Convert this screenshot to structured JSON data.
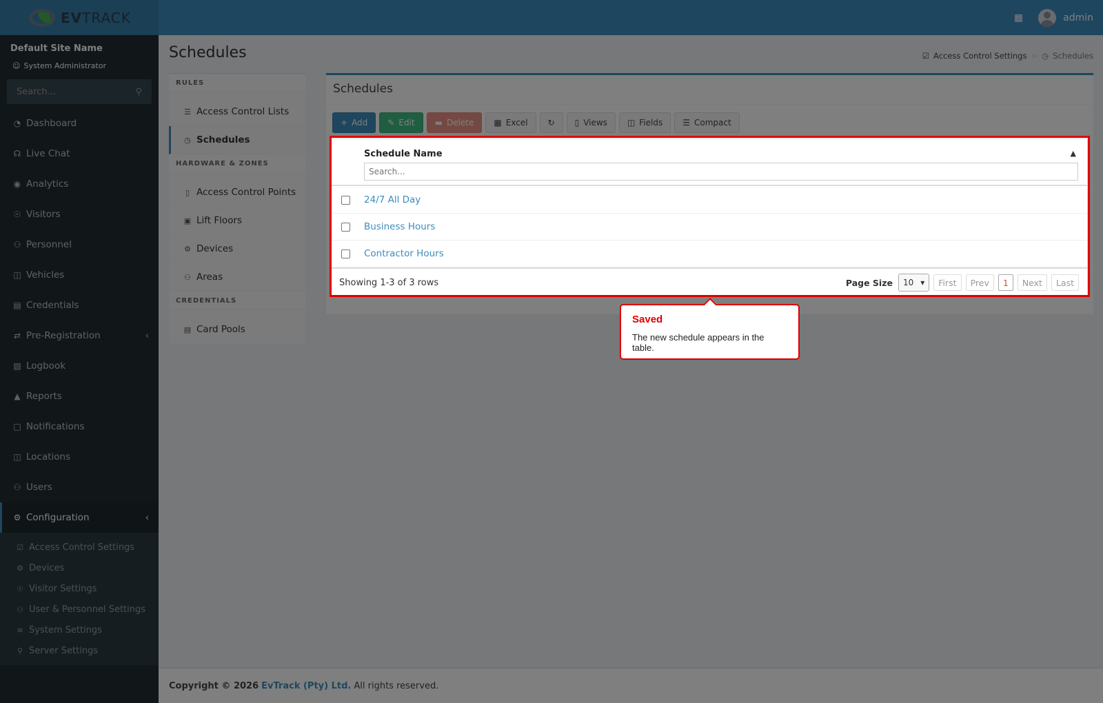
{
  "brand": {
    "logo_bold": "EV",
    "logo_rest": "TRACK",
    "user": "admin",
    "building_icon": "building-icon"
  },
  "sidebar": {
    "site_name": "Default Site Name",
    "role": "System Administrator",
    "search_placeholder": "Search...",
    "items": [
      {
        "label": "Dashboard",
        "icon": "dashboard-icon"
      },
      {
        "label": "Live Chat",
        "icon": "headset-icon"
      },
      {
        "label": "Analytics",
        "icon": "target-icon"
      },
      {
        "label": "Visitors",
        "icon": "eye-icon"
      },
      {
        "label": "Personnel",
        "icon": "user-cog-icon"
      },
      {
        "label": "Vehicles",
        "icon": "car-icon"
      },
      {
        "label": "Credentials",
        "icon": "id-card-icon"
      },
      {
        "label": "Pre-Registration",
        "icon": "arrows-icon"
      },
      {
        "label": "Logbook",
        "icon": "book-icon"
      },
      {
        "label": "Reports",
        "icon": "chart-icon"
      },
      {
        "label": "Notifications",
        "icon": "chat-icon"
      },
      {
        "label": "Locations",
        "icon": "map-icon"
      },
      {
        "label": "Users",
        "icon": "users-icon"
      },
      {
        "label": "Configuration",
        "icon": "gear-icon"
      }
    ],
    "sub_items": [
      {
        "label": "Access Control Settings",
        "icon": "lock-icon"
      },
      {
        "label": "Devices",
        "icon": "cog-icon"
      },
      {
        "label": "Visitor Settings",
        "icon": "eye-icon"
      },
      {
        "label": "User & Personnel Settings",
        "icon": "user-cog-icon"
      },
      {
        "label": "System Settings",
        "icon": "sliders-icon"
      },
      {
        "label": "Server Settings",
        "icon": "server-icon"
      }
    ]
  },
  "page": {
    "title": "Schedules",
    "breadcrumb": {
      "parent": "Access Control Settings",
      "separator": ">",
      "current": "Schedules"
    }
  },
  "left_menu": {
    "sections": [
      {
        "heading": "RULES",
        "items": [
          "Access Control Lists",
          "Schedules"
        ]
      },
      {
        "heading": "HARDWARE & ZONES",
        "items": [
          "Access Control Points",
          "Lift Floors",
          "Devices",
          "Areas"
        ]
      },
      {
        "heading": "CREDENTIALS",
        "items": [
          "Card Pools"
        ]
      }
    ]
  },
  "main": {
    "title": "Schedules",
    "toolbar": {
      "add": "Add",
      "edit": "Edit",
      "delete": "Delete",
      "excel": "Excel",
      "views": "Views",
      "fields": "Fields",
      "compact": "Compact"
    },
    "grid": {
      "column": "Schedule Name",
      "search_placeholder": "Search...",
      "rows": [
        "24/7 All Day",
        "Business Hours",
        "Contractor Hours"
      ],
      "showing": "Showing 1-3 of 3 rows",
      "page_size_label": "Page Size",
      "page_size": "10",
      "pager": {
        "first": "First",
        "prev": "Prev",
        "page": "1",
        "next": "Next",
        "last": "Last"
      }
    }
  },
  "tooltip": {
    "title": "Saved",
    "text": "The new schedule appears in the table."
  },
  "footer": {
    "prefix": "Copyright © 2026",
    "company": "EvTrack (Pty) Ltd.",
    "suffix": "All rights reserved."
  },
  "colors": {
    "primary": "#3c8dbc",
    "sidebar": "#222d32",
    "highlight": "#e00000"
  }
}
